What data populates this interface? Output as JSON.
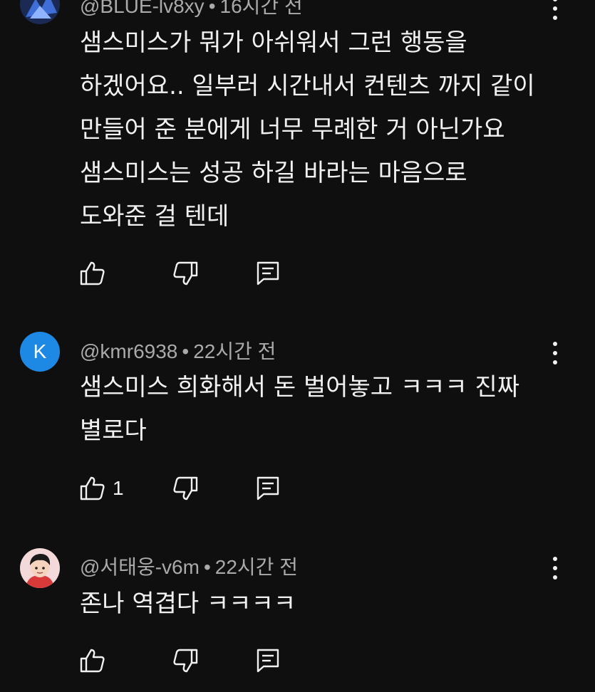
{
  "comments": [
    {
      "handle": "@BLUE-lv8xy",
      "time": "16시간 전",
      "lines": [
        "샘스미스가 뭐가 아쉬워서 그런 행동을",
        "하겠어요.. 일부러 시간내서 컨텐츠 까지 같이",
        "만들어 준 분에게 너무 무례한 거 아닌가요",
        "샘스미스는 성공 하길 바라는 마음으로",
        "도와준 걸 텐데"
      ],
      "likes": ""
    },
    {
      "handle": "@kmr6938",
      "time": "22시간 전",
      "avatar_letter": "K",
      "avatar_color": "#1e88e5",
      "lines": [
        "샘스미스 희화해서 돈 벌어놓고 ㅋㅋㅋ 진짜",
        "별로다"
      ],
      "likes": "1"
    },
    {
      "handle": "@서태웅-v6m",
      "time": "22시간 전",
      "lines": [
        "존나 역겹다 ㅋㅋㅋㅋ"
      ],
      "likes": ""
    }
  ],
  "separator": "•",
  "icons": {
    "like": "thumbs-up-icon",
    "dislike": "thumbs-down-icon",
    "reply": "reply-icon",
    "more": "more-vert-icon"
  },
  "colors": {
    "background": "#0f0f0f",
    "text": "#f1f1f1",
    "meta": "#aaaaaa",
    "avatar_k": "#1e88e5"
  }
}
